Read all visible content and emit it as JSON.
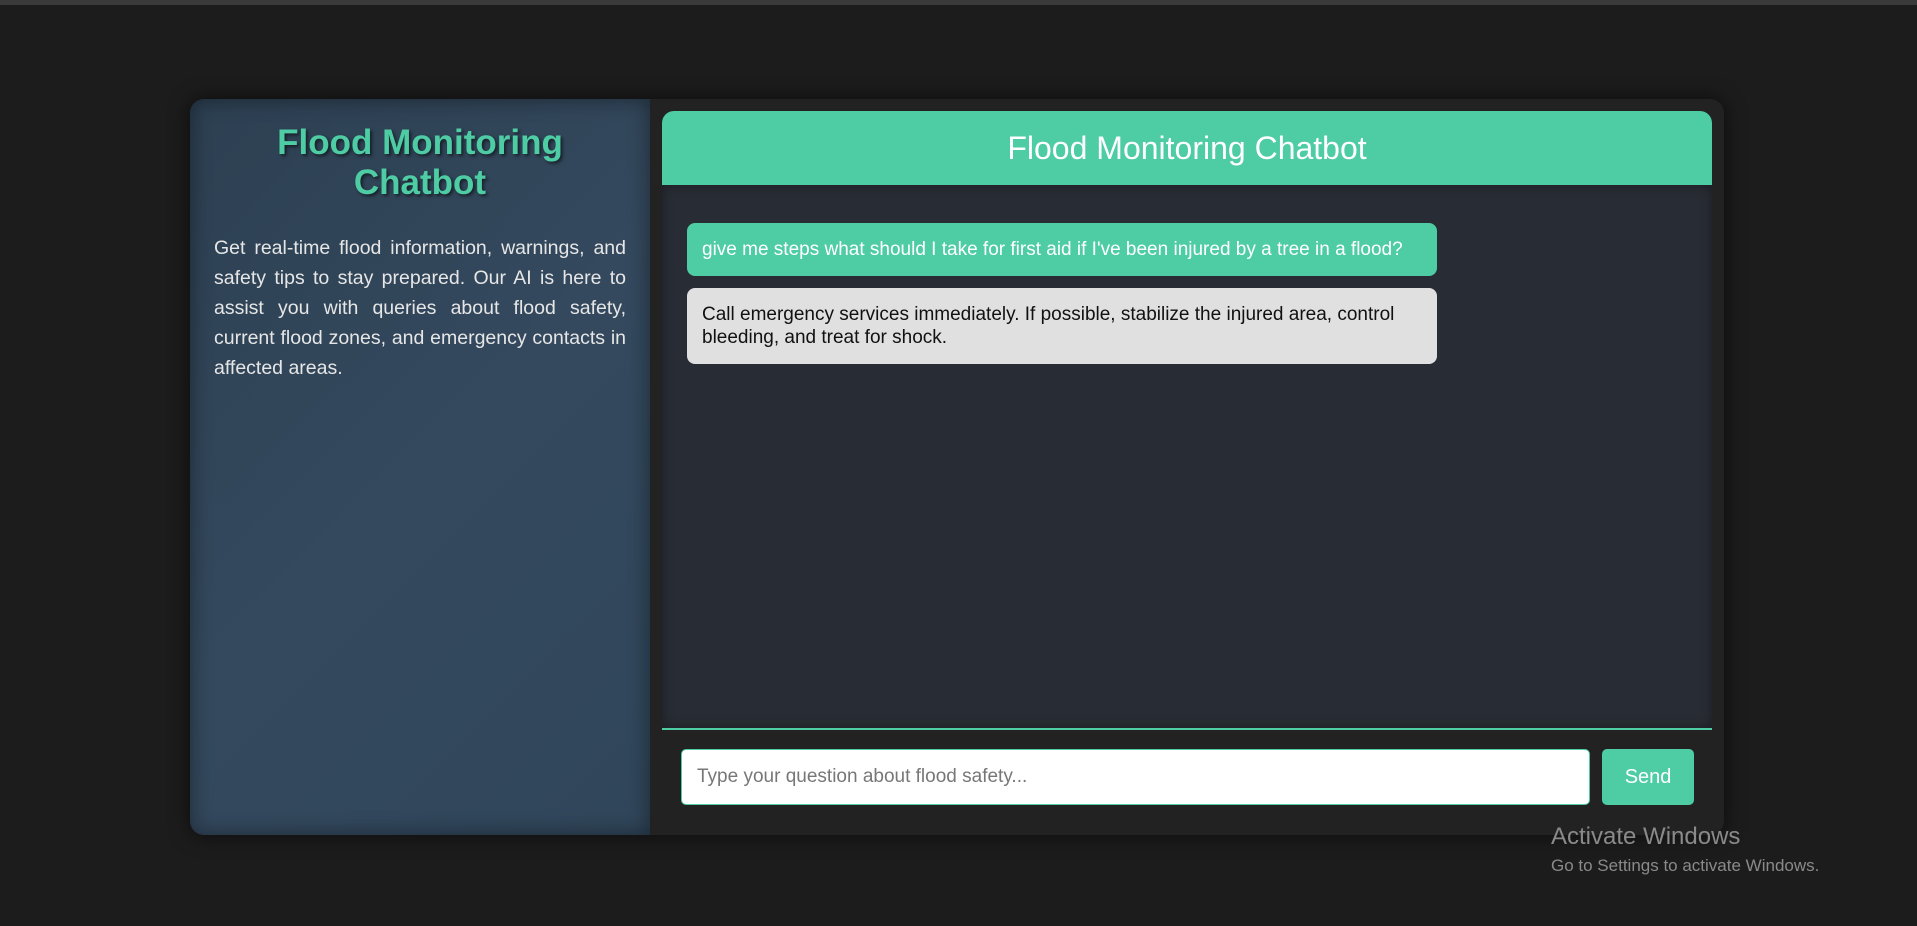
{
  "sidebar": {
    "title": "Flood Monitoring Chatbot",
    "description": "Get real-time flood information, warnings, and safety tips to stay prepared. Our AI is here to assist you with queries about flood safety, current flood zones, and emergency contacts in affected areas."
  },
  "chat": {
    "header_title": "Flood Monitoring Chatbot",
    "messages": [
      {
        "role": "user",
        "text": "give me steps what should I take for first aid if I've been injured by a tree in a flood?"
      },
      {
        "role": "bot",
        "text": "Call emergency services immediately. If possible, stabilize the injured area, control bleeding, and treat for shock."
      }
    ],
    "input_placeholder": "Type your question about flood safety...",
    "input_value": "",
    "send_label": "Send"
  },
  "watermark": {
    "title": "Activate Windows",
    "subtitle": "Go to Settings to activate Windows."
  },
  "colors": {
    "accent": "#4ecca3",
    "page_background": "#1c1c1c",
    "sidebar_background": "#34495e",
    "chat_background": "#282c34",
    "bot_bubble": "#e0e0e0"
  }
}
